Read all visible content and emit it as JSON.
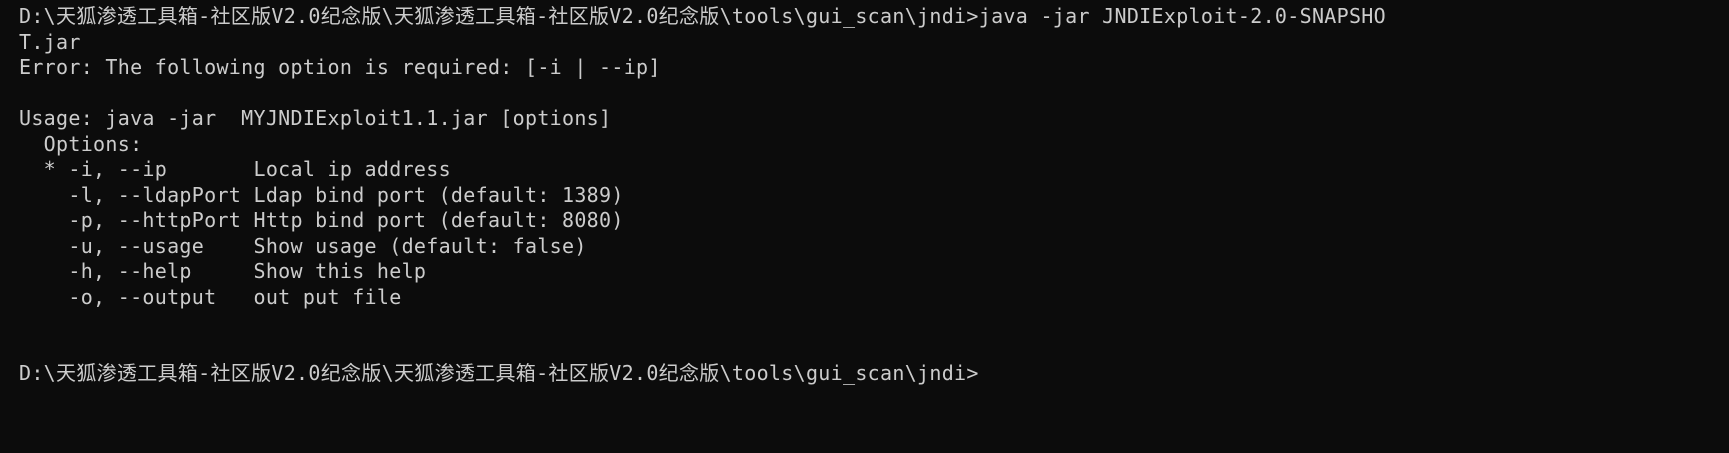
{
  "terminal": {
    "lines": [
      "D:\\天狐渗透工具箱-社区版V2.0纪念版\\天狐渗透工具箱-社区版V2.0纪念版\\tools\\gui_scan\\jndi>java -jar JNDIExploit-2.0-SNAPSHO",
      "T.jar",
      "Error: The following option is required: [-i | --ip]",
      "",
      "Usage: java -jar  MYJNDIExploit1.1.jar [options]",
      "  Options:",
      "  * -i, --ip       Local ip address",
      "    -l, --ldapPort Ldap bind port (default: 1389)",
      "    -p, --httpPort Http bind port (default: 8080)",
      "    -u, --usage    Show usage (default: false)",
      "    -h, --help     Show this help",
      "    -o, --output   out put file",
      "",
      "",
      "D:\\天狐渗透工具箱-社区版V2.0纪念版\\天狐渗透工具箱-社区版V2.0纪念版\\tools\\gui_scan\\jndi>"
    ]
  }
}
